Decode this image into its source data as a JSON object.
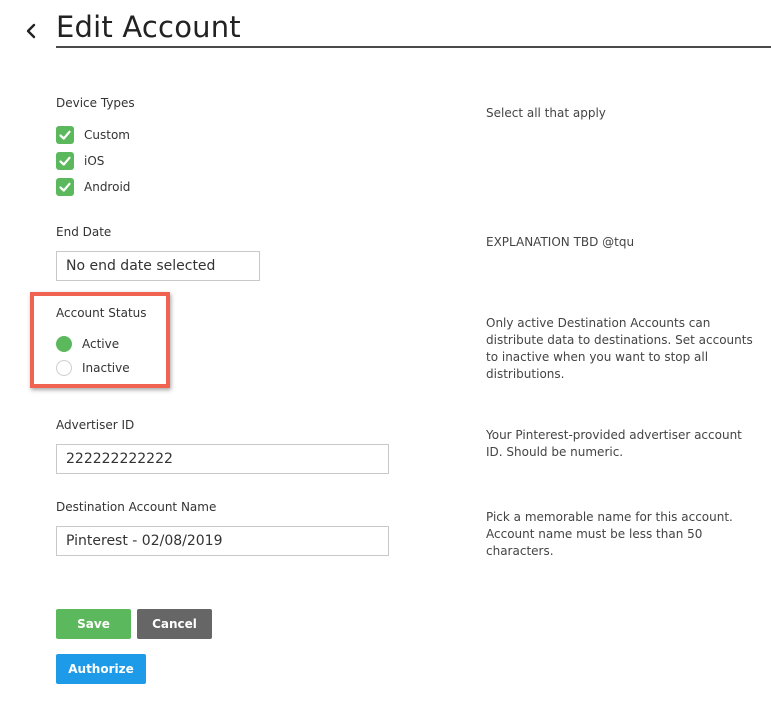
{
  "header": {
    "title": "Edit Account",
    "back_icon": "chevron-left-icon"
  },
  "device_types": {
    "label": "Device Types",
    "help": "Select all that apply",
    "options": [
      {
        "label": "Custom",
        "checked": true
      },
      {
        "label": "iOS",
        "checked": true
      },
      {
        "label": "Android",
        "checked": true
      }
    ]
  },
  "end_date": {
    "label": "End Date",
    "value": "No end date selected",
    "help": "EXPLANATION TBD @tqu"
  },
  "account_status": {
    "label": "Account Status",
    "options": [
      {
        "label": "Active",
        "selected": true
      },
      {
        "label": "Inactive",
        "selected": false
      }
    ],
    "help": "Only active Destination Accounts can distribute data to destinations. Set accounts to inactive when you want to stop all distributions."
  },
  "advertiser_id": {
    "label": "Advertiser ID",
    "value": "222222222222",
    "help": "Your Pinterest-provided advertiser account ID. Should be numeric."
  },
  "destination_name": {
    "label": "Destination Account Name",
    "value": "Pinterest - 02/08/2019",
    "help": "Pick a memorable name for this account. Account name must be less than 50 characters."
  },
  "actions": {
    "save_label": "Save",
    "cancel_label": "Cancel",
    "authorize_label": "Authorize"
  },
  "colors": {
    "accent_green": "#5cb85c",
    "highlight_red": "#f06351",
    "authorize_blue": "#1e9be8",
    "cancel_gray": "#666666"
  }
}
